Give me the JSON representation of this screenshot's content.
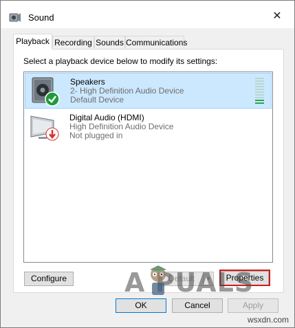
{
  "window": {
    "title": "Sound",
    "close_glyph": "✕",
    "app_icon": "speaker-icon"
  },
  "tabs": [
    {
      "label": "Playback",
      "active": true
    },
    {
      "label": "Recording",
      "active": false
    },
    {
      "label": "Sounds",
      "active": false
    },
    {
      "label": "Communications",
      "active": false
    }
  ],
  "panel": {
    "instructions": "Select a playback device below to modify its settings:"
  },
  "devices": [
    {
      "name": "Speakers",
      "description": "2- High Definition Audio Device",
      "status": "Default Device",
      "icon": "speaker-icon",
      "badge": "checkmark-badge",
      "selected": true,
      "level_meter": {
        "segments": 10,
        "active_segments": 2
      }
    },
    {
      "name": "Digital Audio (HDMI)",
      "description": "High Definition Audio Device",
      "status": "Not plugged in",
      "icon": "monitor-icon",
      "badge": "unplugged-badge",
      "selected": false
    }
  ],
  "panel_buttons": {
    "configure": "Configure",
    "set_default": "Default",
    "properties": "Properties"
  },
  "dialog_buttons": {
    "ok": "OK",
    "cancel": "Cancel",
    "apply": "Apply"
  },
  "watermark": {
    "text": "A  PUALS",
    "site": "wsxdn.com"
  },
  "colors": {
    "selection_bg": "#cce8ff",
    "selection_border": "#99d1ff",
    "highlight_box": "#d11a1a",
    "default_badge": "#1e9b3c",
    "unplugged_badge": "#d32f2f"
  }
}
